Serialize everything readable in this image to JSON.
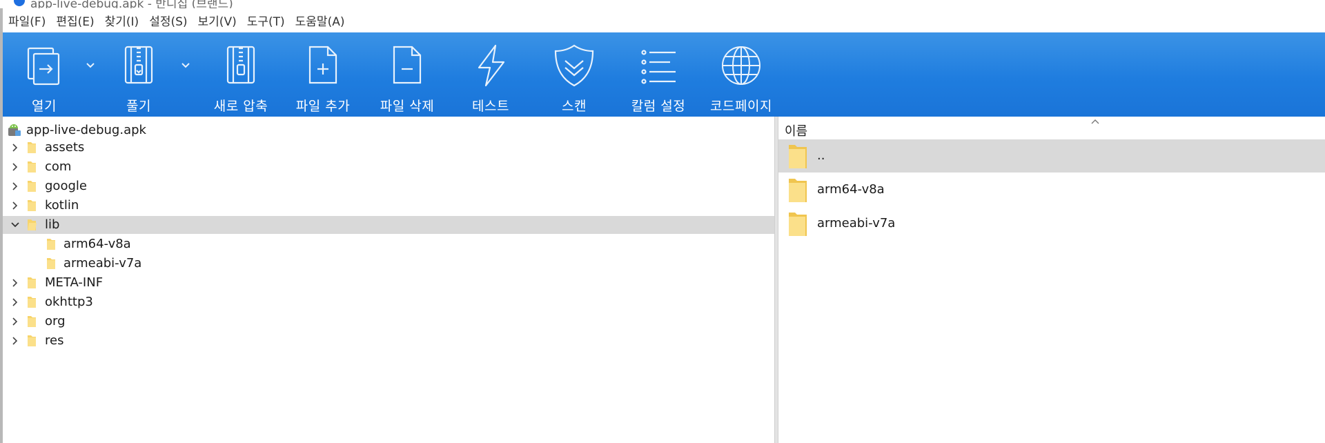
{
  "window": {
    "title": "app-live-debug.apk - 반디집 (브랜드)"
  },
  "menubar": [
    "파일(F)",
    "편집(E)",
    "찾기(I)",
    "설정(S)",
    "보기(V)",
    "도구(T)",
    "도움말(A)"
  ],
  "toolbar": {
    "buttons": [
      {
        "label": "열기",
        "icon": "open-archive-icon"
      },
      {
        "label": "풀기",
        "icon": "extract-zip-icon"
      },
      {
        "label": "새로 압축",
        "icon": "new-archive-zip-icon"
      },
      {
        "label": "파일 추가",
        "icon": "add-file-icon"
      },
      {
        "label": "파일 삭제",
        "icon": "delete-file-icon"
      },
      {
        "label": "테스트",
        "icon": "lightning-icon"
      },
      {
        "label": "스캔",
        "icon": "shield-icon"
      },
      {
        "label": "칼럼 설정",
        "icon": "list-columns-icon"
      },
      {
        "label": "코드페이지",
        "icon": "globe-icon"
      }
    ]
  },
  "tree": {
    "root": "app-live-debug.apk",
    "items": [
      {
        "name": "assets",
        "level": 1,
        "expanded": false
      },
      {
        "name": "com",
        "level": 1,
        "expanded": false
      },
      {
        "name": "google",
        "level": 1,
        "expanded": false
      },
      {
        "name": "kotlin",
        "level": 1,
        "expanded": false
      },
      {
        "name": "lib",
        "level": 1,
        "expanded": true,
        "selected": true
      },
      {
        "name": "arm64-v8a",
        "level": 2
      },
      {
        "name": "armeabi-v7a",
        "level": 2
      },
      {
        "name": "META-INF",
        "level": 1,
        "expanded": false
      },
      {
        "name": "okhttp3",
        "level": 1,
        "expanded": false
      },
      {
        "name": "org",
        "level": 1,
        "expanded": false
      },
      {
        "name": "res",
        "level": 1,
        "expanded": false
      }
    ]
  },
  "filelist": {
    "column_name": "이름",
    "items": [
      {
        "name": "..",
        "selected": true
      },
      {
        "name": "arm64-v8a"
      },
      {
        "name": "armeabi-v7a"
      }
    ]
  },
  "colors": {
    "toolbar_top": "#3b93e6",
    "toolbar_bottom": "#1a74d8",
    "selection": "#d9d9d9",
    "folder": "#f7d46b"
  }
}
